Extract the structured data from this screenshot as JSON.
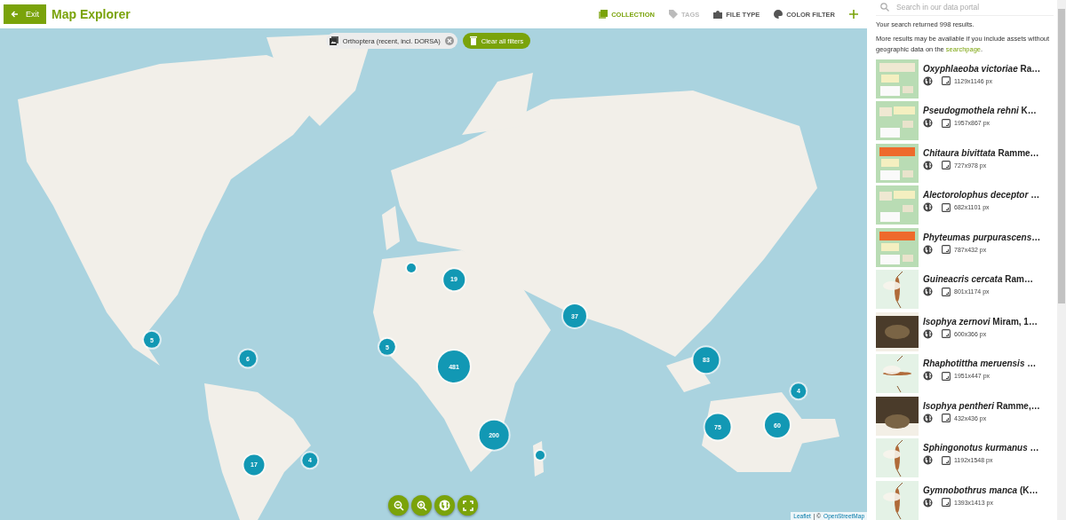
{
  "header": {
    "exit_button": "Exit",
    "title": "Map Explorer",
    "filters": [
      {
        "label": "COLLECTION",
        "selected": true,
        "disabled": false
      },
      {
        "label": "TAGS",
        "selected": false,
        "disabled": true
      },
      {
        "label": "FILE TYPE",
        "selected": false,
        "disabled": false
      },
      {
        "label": "COLOR FILTER",
        "selected": false,
        "disabled": false
      }
    ]
  },
  "search": {
    "placeholder": "Search in our data portal"
  },
  "active_filter": {
    "label": "Orthoptera (recent, incl. DORSA)",
    "clear_button": "Clear all filters"
  },
  "map": {
    "markers": [
      {
        "kind": "cluster",
        "count": "5"
      },
      {
        "kind": "cluster",
        "count": "6"
      },
      {
        "kind": "cluster",
        "count": "17"
      },
      {
        "kind": "cluster",
        "count": "4"
      },
      {
        "kind": "cluster",
        "count": "5"
      },
      {
        "kind": "point"
      },
      {
        "kind": "cluster",
        "count": "19"
      },
      {
        "kind": "cluster",
        "count": "481"
      },
      {
        "kind": "cluster",
        "count": "200"
      },
      {
        "kind": "point"
      },
      {
        "kind": "cluster",
        "count": "37"
      },
      {
        "kind": "cluster",
        "count": "83"
      },
      {
        "kind": "cluster",
        "count": "75"
      },
      {
        "kind": "cluster",
        "count": "60"
      },
      {
        "kind": "cluster",
        "count": "4"
      }
    ],
    "attribution": {
      "leaflet": "Leaflet",
      "separator": "| ©",
      "osm": "OpenStreetMap"
    }
  },
  "results": {
    "summary": "Your search returned 998 results.",
    "note": "More results may be available if you include assets without geographic data on the",
    "link": "searchpage",
    "note_end": ".",
    "items": [
      {
        "title": "*Oxyphlaeoba victoriae* Ra…",
        "size": "1129x1146",
        "unit": "px"
      },
      {
        "title": "*Pseudogmothela rehni* K…",
        "size": "1957x867",
        "unit": "px"
      },
      {
        "title": "*Chitaura bivittata* Ramme…",
        "size": "727x978",
        "unit": "px"
      },
      {
        "title": "*Alectorolophus deceptor* …",
        "size": "682x1101",
        "unit": "px"
      },
      {
        "title": "*Phyteumas purpurascens*…",
        "size": "787x432",
        "unit": "px"
      },
      {
        "title": "*Guineacris cercata* Ram…",
        "size": "801x1174",
        "unit": "px"
      },
      {
        "title": "*Isophya zernovi* Miram, 1…",
        "size": "600x366",
        "unit": "px"
      },
      {
        "title": "*Rhaphotittha meruensis* …",
        "size": "1951x447",
        "unit": "px"
      },
      {
        "title": "*Isophya pentheri* Ramme,…",
        "size": "432x436",
        "unit": "px"
      },
      {
        "title": "*Sphingonotus kurmanus* …",
        "size": "1192x1548",
        "unit": "px"
      },
      {
        "title": "*Gymnobothrus manca* (K…",
        "size": "1393x1413",
        "unit": "px"
      }
    ]
  }
}
